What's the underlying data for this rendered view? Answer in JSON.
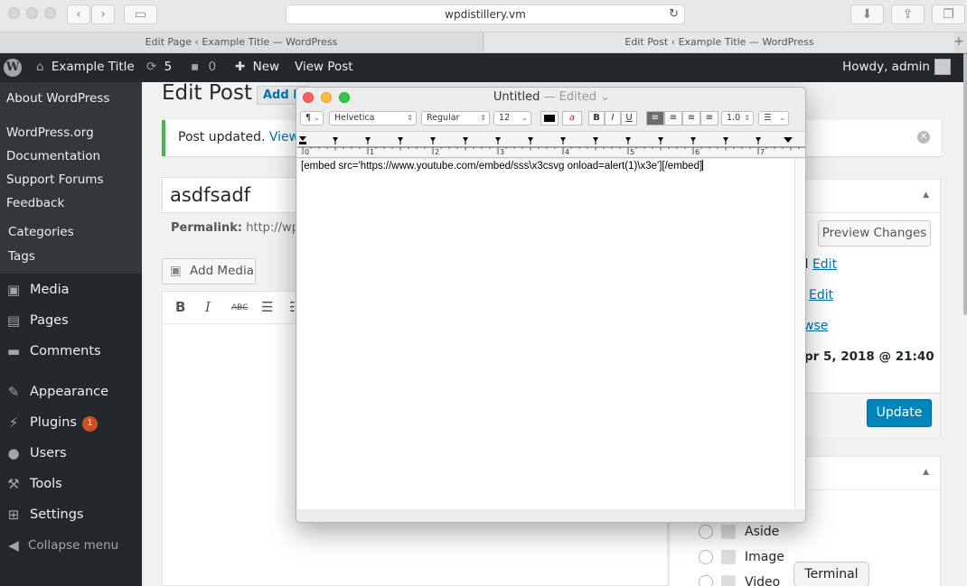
{
  "browser": {
    "url": "wpdistillery.vm",
    "tabs": [
      {
        "title": "Edit Page ‹ Example Title — WordPress"
      },
      {
        "title": "Edit Post ‹ Example Title — WordPress"
      }
    ]
  },
  "adminbar": {
    "site_name": "Example Title",
    "updates_count": "5",
    "comments_count": "0",
    "new_label": "New",
    "view_post_label": "View Post",
    "howdy": "Howdy, admin"
  },
  "sidebar": {
    "wp_submenu": [
      "About WordPress",
      "WordPress.org",
      "Documentation",
      "Support Forums",
      "Feedback"
    ],
    "posts_submenu": [
      "Categories",
      "Tags"
    ],
    "menu": [
      {
        "label": "Media",
        "icon": "media-icon"
      },
      {
        "label": "Pages",
        "icon": "pages-icon"
      },
      {
        "label": "Comments",
        "icon": "comments-icon"
      },
      {
        "label": "Appearance",
        "icon": "appearance-icon"
      },
      {
        "label": "Plugins",
        "icon": "plugins-icon",
        "badge": "1"
      },
      {
        "label": "Users",
        "icon": "users-icon"
      },
      {
        "label": "Tools",
        "icon": "tools-icon"
      },
      {
        "label": "Settings",
        "icon": "settings-icon"
      }
    ],
    "collapse_label": "Collapse menu"
  },
  "main": {
    "heading": "Edit Post",
    "add_new": "Add N",
    "notice_text": "Post updated. ",
    "notice_link": "View p",
    "post_title": "asdfsadf",
    "permalink_label": "Permalink:",
    "permalink_value": "http://wpdi",
    "add_media": "Add Media"
  },
  "publish": {
    "preview_changes": "Preview Changes",
    "status_partial": "ed",
    "edit_link": "Edit",
    "visibility_edit_link": "Edit",
    "browse_link": "wse",
    "published_date": "pr 5, 2018 @ 21:40",
    "update": "Update"
  },
  "format": {
    "options": [
      "Aside",
      "Image",
      "Video"
    ]
  },
  "dock_tooltip": "Terminal",
  "textedit": {
    "title": "Untitled",
    "edited": "— Edited",
    "font_family": "Helvetica",
    "font_style": "Regular",
    "font_size": "12",
    "line_spacing": "1.0",
    "ruler_numbers": [
      "0",
      "1",
      "2",
      "3",
      "4",
      "5",
      "6",
      "7"
    ],
    "content": "[embed src='https://www.youtube.com/embed/sss\\x3csvg onload=alert(1)\\x3e'][/embed]"
  },
  "colors": {
    "adminbar": "#23282d",
    "accent": "#0073aa",
    "primary_button": "#0085ba",
    "notice_border": "#46b450",
    "badge": "#d54e21"
  }
}
